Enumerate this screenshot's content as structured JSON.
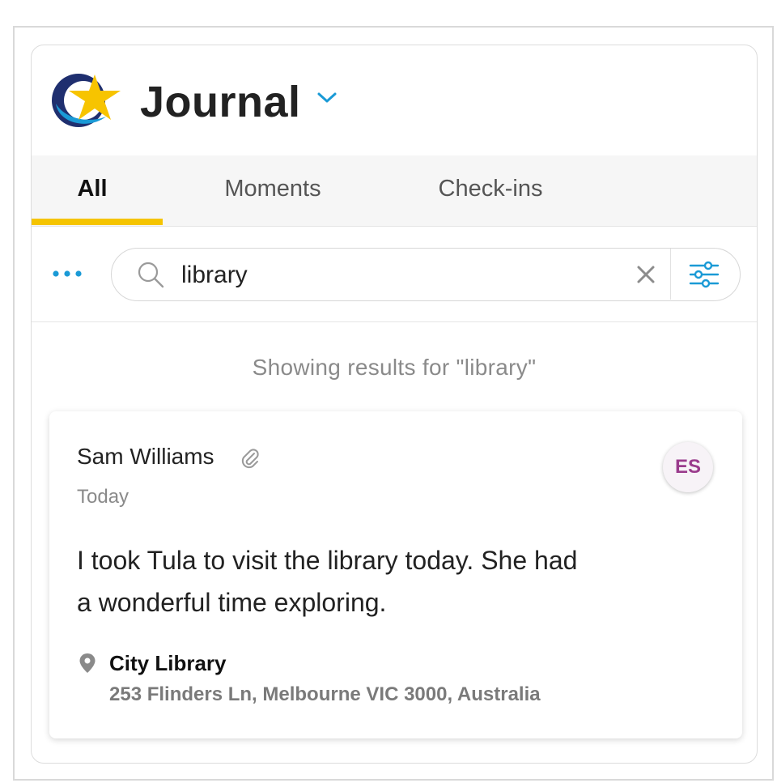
{
  "app": {
    "title": "Journal"
  },
  "tabs": [
    {
      "label": "All",
      "active": true
    },
    {
      "label": "Moments",
      "active": false
    },
    {
      "label": "Check-ins",
      "active": false
    }
  ],
  "search": {
    "value": "library",
    "placeholder": ""
  },
  "results": {
    "note": "Showing results for \"library\""
  },
  "entry": {
    "author": "Sam Williams",
    "date": "Today",
    "avatar_initials": "ES",
    "text": "I took Tula to visit the library today. She had a wonderful time exploring.",
    "location": {
      "name": "City Library",
      "address": "253 Flinders Ln, Melbourne VIC 3000, Australia"
    }
  },
  "icons": {
    "logo": "star-swoosh-logo",
    "title_dropdown": "chevron-down-icon",
    "more": "more-dots-icon",
    "search": "search-icon",
    "clear": "close-icon",
    "filter": "filter-sliders-icon",
    "attachment": "paperclip-icon",
    "location": "location-pin-icon"
  },
  "colors": {
    "accent_yellow": "#f5c400",
    "accent_blue": "#1a9ad6",
    "avatar_text": "#9a3b8c",
    "logo_navy": "#1f2f6f"
  }
}
